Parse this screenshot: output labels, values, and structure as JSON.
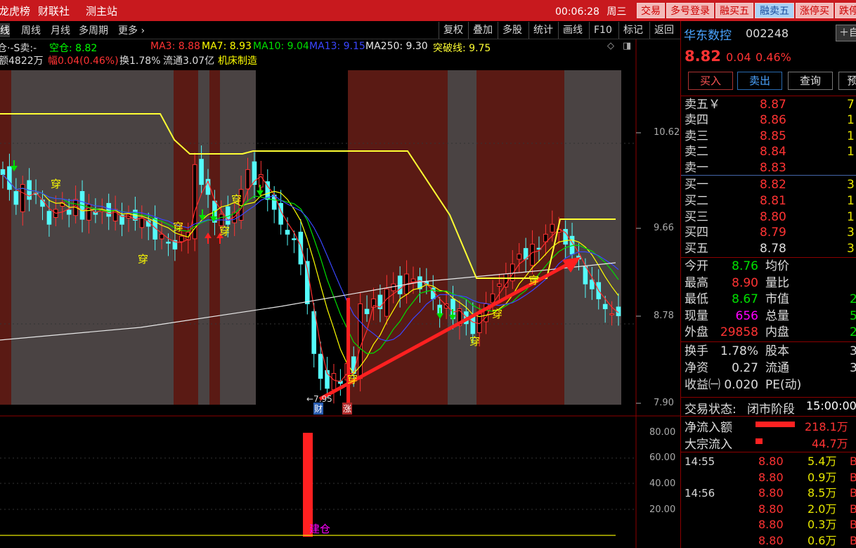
{
  "topbar": {
    "nav": [
      "龙虎榜",
      "财联社",
      "测主站"
    ],
    "time": "00:06:28",
    "weekday": "周三",
    "buttons": [
      "交易",
      "多号登录",
      "融买五",
      "融卖五",
      "涨停买",
      "跌停"
    ]
  },
  "toolbar": {
    "periods": [
      "线",
      "周线",
      "月线",
      "多周期",
      "更多 ›"
    ],
    "right": [
      "复权",
      "叠加",
      "多股",
      "统计",
      "画线",
      "F10",
      "标记",
      "返回"
    ]
  },
  "indicators": {
    "s": "仓·-S卖:-",
    "kong_label": "空仓:",
    "kong": "8.82",
    "ma3": "MA3: 8.88",
    "ma7": "MA7: 8.93",
    "ma10": "MA10: 9.04",
    "ma13": "MA13: 9.15",
    "ma250": "MA250: 9.30",
    "tupo": "突破线: 9.75"
  },
  "info": {
    "amount": "额4822万",
    "change": "幅0.04(0.46%)",
    "turnover": "换1.78%",
    "float": "流通3.07亿",
    "sector": "机床制造"
  },
  "y_ticks": [
    "10.62",
    "9.66",
    "8.78",
    "7.90"
  ],
  "sub_ticks": [
    "80.00",
    "60.00",
    "40.00",
    "20.00"
  ],
  "markers": {
    "low": "←7.95",
    "cai": "财",
    "zhang": "涨",
    "jiancang": "建仓",
    "chuan": "穿"
  },
  "colors": {
    "up": "#ff3333",
    "down": "#54fcfc",
    "bgband": "#5a1a14",
    "bggray": "#4a4343",
    "ma3": "#ff2d2d",
    "ma7": "#ffff00",
    "ma10": "#00e000",
    "ma13": "#3a46ff",
    "ma250": "#e8e8e8",
    "tupo": "#ffff33"
  },
  "chart_data": {
    "type": "candlestick",
    "ylim": [
      7.9,
      10.62
    ],
    "closes": [
      10.2,
      10.05,
      9.9,
      10.1,
      9.95,
      10.0,
      9.88,
      9.7,
      9.85,
      9.92,
      9.8,
      9.95,
      9.75,
      9.9,
      9.8,
      9.84,
      9.78,
      9.85,
      9.7,
      9.8,
      9.74,
      9.76,
      9.68,
      9.55,
      9.6,
      9.52,
      9.45,
      9.58,
      9.62,
      10.3,
      10.1,
      10.0,
      9.72,
      9.8,
      9.7,
      9.82,
      10.05,
      10.25,
      10.1,
      10.2,
      9.95,
      9.85,
      9.7,
      9.6,
      9.55,
      9.3,
      8.9,
      8.4,
      8.15,
      8.05,
      8.2,
      8.1,
      8.3,
      8.2,
      8.9,
      8.8,
      8.95,
      8.85,
      9.05,
      9.1,
      9.0,
      9.2,
      9.15,
      9.05,
      9.1,
      8.95,
      8.8,
      8.9,
      8.75,
      8.85,
      8.7,
      8.6,
      8.8,
      8.9,
      9.0,
      9.1,
      9.2,
      9.3,
      9.4,
      9.35,
      9.5,
      9.45,
      9.6,
      9.7,
      9.65,
      9.5,
      9.4,
      9.35,
      9.1,
      9.05,
      8.95,
      8.85,
      8.8,
      8.78
    ]
  },
  "panel": {
    "name": "华东数控",
    "code": "002248",
    "mode": "自",
    "price": "8.82",
    "chg": "0.04",
    "pct": "0.46%",
    "buttons": [
      "买入",
      "卖出",
      "查询",
      "预"
    ],
    "asks": [
      [
        "卖五￥",
        "8.87",
        "7"
      ],
      [
        "卖四",
        "8.86",
        "1"
      ],
      [
        "卖三",
        "8.85",
        "1"
      ],
      [
        "卖二",
        "8.84",
        "1"
      ],
      [
        "卖一",
        "8.83",
        ""
      ]
    ],
    "bids": [
      [
        "买一",
        "8.82",
        "3"
      ],
      [
        "买二",
        "8.81",
        "1"
      ],
      [
        "买三",
        "8.80",
        "1"
      ],
      [
        "买四",
        "8.79",
        "3"
      ],
      [
        "买五",
        "8.78",
        "3"
      ]
    ],
    "stats": [
      [
        "今开",
        "8.76",
        "均价",
        ""
      ],
      [
        "最高",
        "8.90",
        "量比",
        ""
      ],
      [
        "最低",
        "8.67",
        "市值",
        "2"
      ],
      [
        "现量",
        "656",
        "总量",
        "5"
      ],
      [
        "外盘",
        "29858",
        "内盘",
        "2"
      ]
    ],
    "stats2": [
      [
        "换手",
        "1.78%",
        "股本",
        "3"
      ],
      [
        "净资",
        "0.27",
        "流通",
        "3"
      ],
      [
        "收益㈠",
        "0.020",
        "PE(动)",
        ""
      ]
    ],
    "status_label": "交易状态:",
    "status": "闭市阶段",
    "status_time": "15:00:00",
    "flows": [
      [
        "净流入额",
        "218.1万"
      ],
      [
        "大宗流入",
        "44.7万"
      ]
    ],
    "ticks": [
      [
        "14:55",
        "8.80",
        "5.4万",
        "B"
      ],
      [
        "",
        "8.80",
        "0.9万",
        "B"
      ],
      [
        "14:56",
        "8.80",
        "8.5万",
        "B"
      ],
      [
        "",
        "8.80",
        "2.0万",
        "B"
      ],
      [
        "",
        "8.80",
        "0.3万",
        "B"
      ],
      [
        "",
        "8.80",
        "0.6万",
        "B"
      ]
    ]
  }
}
